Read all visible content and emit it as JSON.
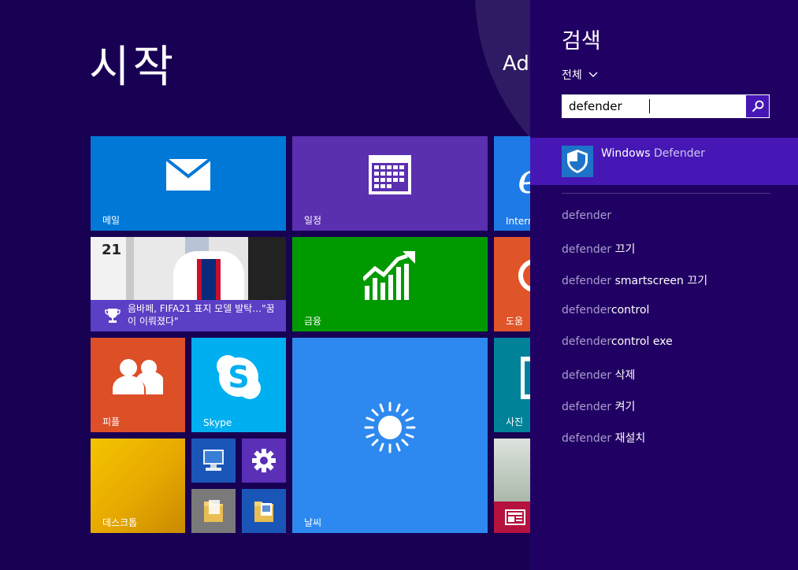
{
  "start": {
    "title": "시작",
    "user_name_partial": "Ad",
    "tiles": {
      "mail": "메일",
      "calendar": "일정",
      "ie": "Intern",
      "news_headline": "음바페, FIFA21 표지 모델 발탁…\"꿈이 이뤄졌다\"",
      "news_image_text": "21",
      "finance": "금융",
      "help": "도움",
      "people": "피플",
      "skype": "Skype",
      "weather": "날씨",
      "photos": "사진",
      "desktop": "데스크톱"
    }
  },
  "search_pane": {
    "title": "검색",
    "scope_label": "전체",
    "query": "defender",
    "top_result": {
      "match": "Windows ",
      "rest": "Defender"
    },
    "suggestions": [
      {
        "match": "defender",
        "rest": ""
      },
      {
        "match": "defender",
        "rest": " 끄기"
      },
      {
        "match": "defender",
        "rest": " smartscreen 끄기"
      },
      {
        "match": "defender",
        "rest": "control"
      },
      {
        "match": "defender",
        "rest": "control exe"
      },
      {
        "match": "defender",
        "rest": " 삭제"
      },
      {
        "match": "defender",
        "rest": " 켜기"
      },
      {
        "match": "defender",
        "rest": " 재설치"
      }
    ]
  },
  "colors": {
    "background": "#180053",
    "pane": "#210063",
    "accent": "#4617b4"
  },
  "icons": [
    "mail-icon",
    "calendar-icon",
    "ie-icon",
    "trophy-icon",
    "finance-icon",
    "help-icon",
    "people-icon",
    "skype-icon",
    "weather-sun-icon",
    "photos-icon",
    "pc-icon",
    "settings-gear-icon",
    "folder-icon",
    "documents-icon",
    "news-icon",
    "search-icon",
    "chevron-down-icon",
    "defender-shield-icon"
  ]
}
